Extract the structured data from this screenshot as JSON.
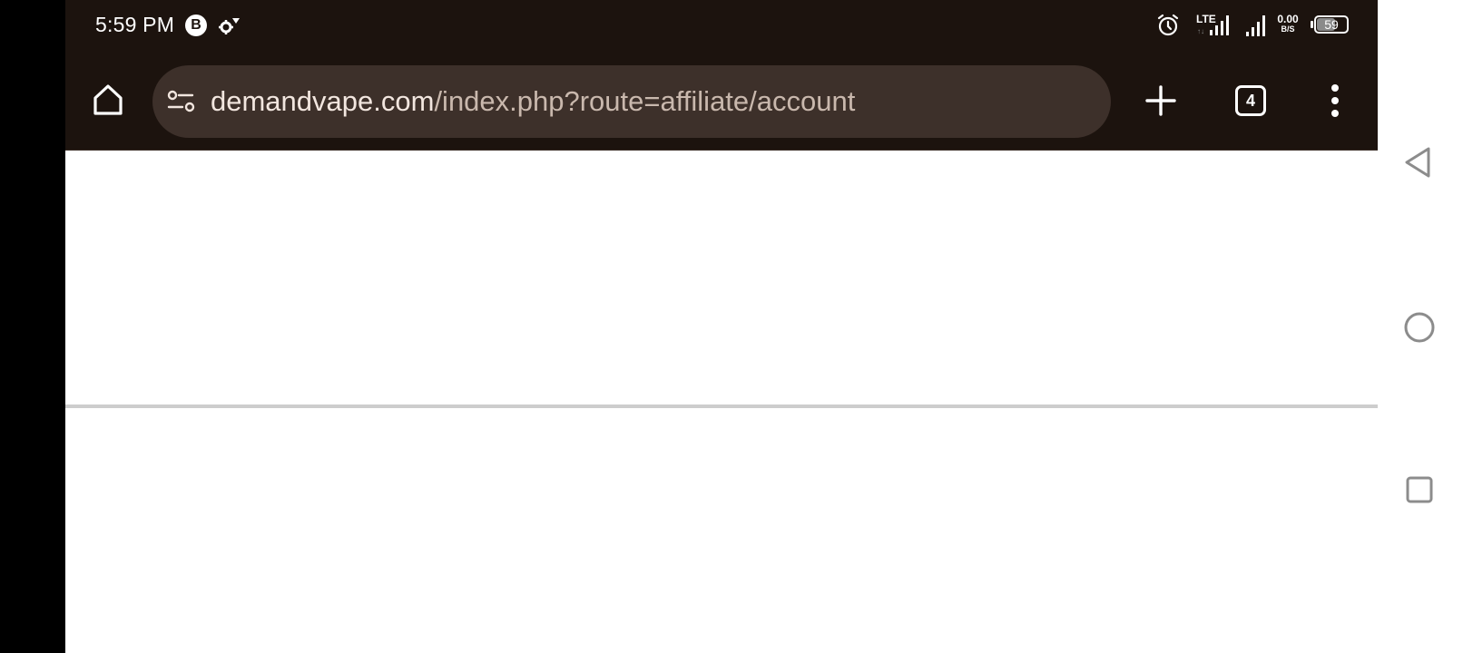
{
  "status_bar": {
    "time": "5:59 PM",
    "notification_badge": "B",
    "network_type": "LTE",
    "speed_value": "0.00",
    "speed_unit": "B/S",
    "battery_level": "59",
    "battery_fraction": 0.59,
    "icons": [
      "b-badge-icon",
      "gear-icon",
      "alarm-icon",
      "lte-signal-icon",
      "signal-icon",
      "battery-icon"
    ]
  },
  "browser": {
    "url_domain": "demandvape.com",
    "url_path": "/index.php?route=affiliate/account",
    "tab_count": "4",
    "icons": [
      "home-icon",
      "site-settings-icon",
      "plus-icon",
      "tabs-icon",
      "more-vert-icon"
    ]
  },
  "nav_bar": {
    "icons": [
      "back-icon",
      "home-circle-icon",
      "recents-icon"
    ]
  },
  "colors": {
    "toolbar_bg": "#1c130e",
    "url_bar_bg": "#3d302a",
    "url_domain": "#f2e6df",
    "url_path": "#c9b8ad",
    "page_bg": "#ffffff",
    "divider": "#cdcdcd",
    "nav_icon": "#8c8c8c"
  }
}
